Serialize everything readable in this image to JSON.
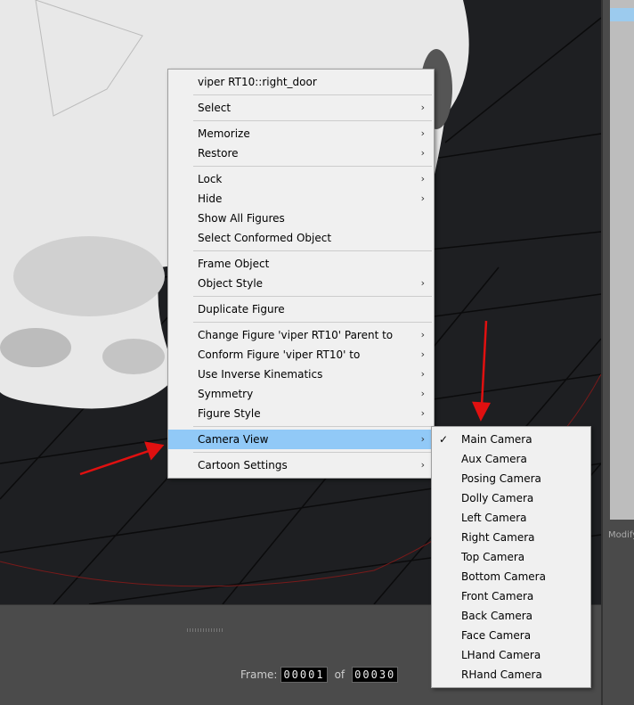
{
  "context_menu": {
    "title": "viper RT10::right_door",
    "groups": [
      [
        {
          "label": "Select",
          "submenu": true
        }
      ],
      [
        {
          "label": "Memorize",
          "submenu": true
        },
        {
          "label": "Restore",
          "submenu": true
        }
      ],
      [
        {
          "label": "Lock",
          "submenu": true
        },
        {
          "label": "Hide",
          "submenu": true
        },
        {
          "label": "Show All Figures",
          "submenu": false
        },
        {
          "label": "Select Conformed Object",
          "submenu": false
        }
      ],
      [
        {
          "label": "Frame Object",
          "submenu": false
        },
        {
          "label": "Object Style",
          "submenu": true
        }
      ],
      [
        {
          "label": "Duplicate Figure",
          "submenu": false
        }
      ],
      [
        {
          "label": "Change Figure 'viper RT10' Parent to",
          "submenu": true
        },
        {
          "label": "Conform Figure 'viper RT10' to",
          "submenu": true
        },
        {
          "label": "Use Inverse Kinematics",
          "submenu": true
        },
        {
          "label": "Symmetry",
          "submenu": true
        },
        {
          "label": "Figure Style",
          "submenu": true
        }
      ],
      [
        {
          "label": "Camera View",
          "submenu": true,
          "highlighted": true
        }
      ],
      [
        {
          "label": "Cartoon Settings",
          "submenu": true
        }
      ]
    ]
  },
  "camera_submenu": {
    "checked": "Main Camera",
    "items": [
      "Main Camera",
      "Aux Camera",
      "Posing Camera",
      "Dolly Camera",
      "Left Camera",
      "Right Camera",
      "Top Camera",
      "Bottom Camera",
      "Front Camera",
      "Back Camera",
      "Face Camera",
      "LHand Camera",
      "RHand Camera"
    ]
  },
  "frame": {
    "label": "Frame:",
    "current": "00001",
    "of_label": "of",
    "total": "00030"
  },
  "right_panel": {
    "modify_label": "Modify"
  },
  "colors": {
    "highlight": "#91c9f7",
    "arrow": "#e01010"
  }
}
